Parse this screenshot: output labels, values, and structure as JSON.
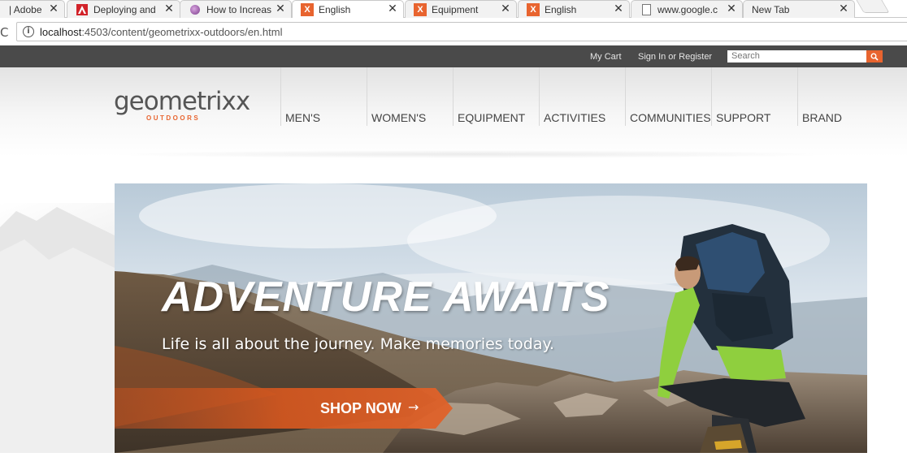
{
  "browser": {
    "tabs": [
      {
        "title": "| Adobe",
        "icon": "page-icon",
        "active": false
      },
      {
        "title": "Deploying and",
        "icon": "adobe-icon",
        "active": false
      },
      {
        "title": "How to Increas",
        "icon": "purple-ball-icon",
        "active": false
      },
      {
        "title": "English",
        "icon": "geometrixx-icon",
        "active": true
      },
      {
        "title": "Equipment",
        "icon": "geometrixx-icon",
        "active": false
      },
      {
        "title": "English",
        "icon": "geometrixx-icon",
        "active": false
      },
      {
        "title": "www.google.c",
        "icon": "document-icon",
        "active": false
      },
      {
        "title": "New Tab",
        "icon": "none",
        "active": false
      }
    ],
    "close_glyph": "✕",
    "address": {
      "host": "localhost",
      "path": ":4503/content/geometrixx-outdoors/en.html"
    }
  },
  "site": {
    "topbar": {
      "cart_label": "My Cart",
      "signin_label": "Sign In or Register",
      "search_placeholder": "Search"
    },
    "logo": {
      "name": "geometrixx",
      "sub": "OUTDOORS"
    },
    "nav": [
      {
        "label": "MEN'S"
      },
      {
        "label": "WOMEN'S"
      },
      {
        "label": "EQUIPMENT"
      },
      {
        "label": "ACTIVITIES"
      },
      {
        "label": "COMMUNITIES"
      },
      {
        "label": "SUPPORT"
      },
      {
        "label": "BRAND"
      }
    ],
    "hero": {
      "title": "ADVENTURE AWAITS",
      "subtitle": "Life is all about the journey. Make memories today.",
      "cta_label": "SHOP NOW",
      "cta_arrow": "→"
    }
  },
  "colors": {
    "brand_orange": "#e8642f",
    "topbar_bg": "#4a4a4a"
  }
}
